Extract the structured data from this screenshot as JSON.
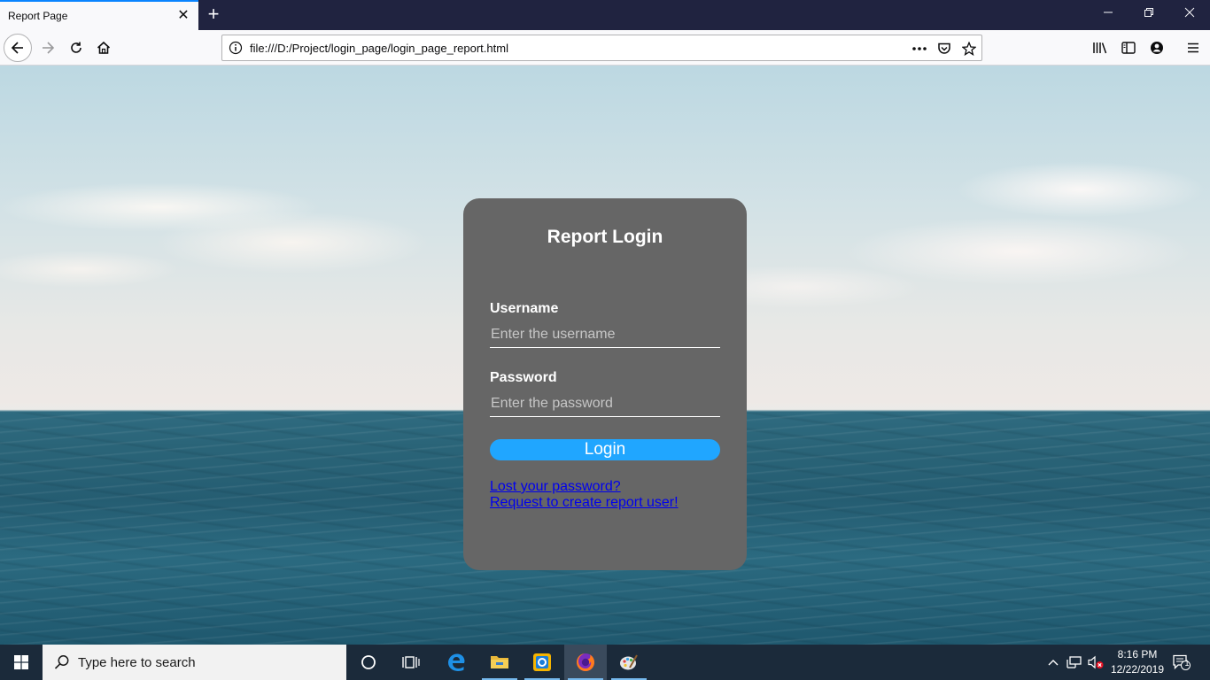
{
  "browser": {
    "tab_title": "Report Page",
    "url": "file:///D:/Project/login_page/login_page_report.html"
  },
  "login": {
    "title": "Report Login",
    "username_label": "Username",
    "username_placeholder": "Enter the username",
    "password_label": "Password",
    "password_placeholder": "Enter the password",
    "button_label": "Login",
    "lost_password_link": "Lost your password?",
    "request_user_link": "Request to create report user!"
  },
  "taskbar": {
    "search_placeholder": "Type here to search",
    "time": "8:16 PM",
    "date": "12/22/2019",
    "notification_count": "1"
  },
  "colors": {
    "card_background": "#666666",
    "button_accent": "#20a6ff",
    "link": "#0000ee",
    "tab_accent": "#0a84ff"
  }
}
